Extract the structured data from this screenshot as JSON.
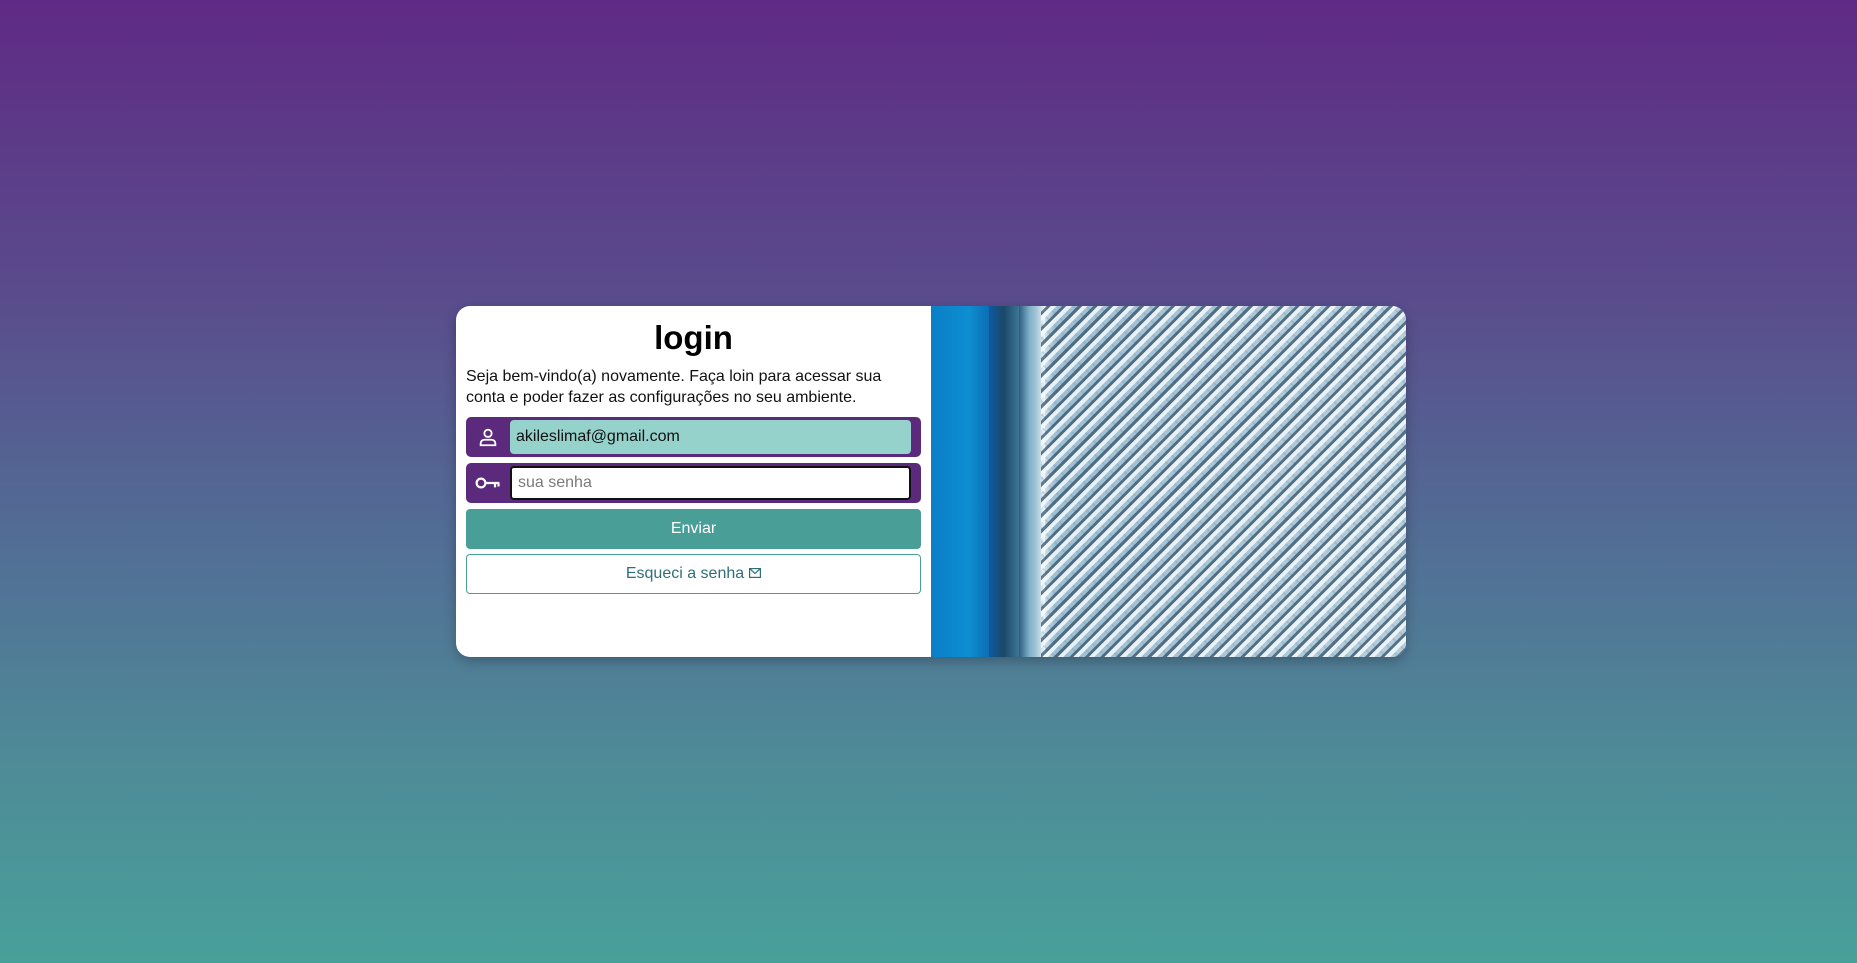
{
  "login": {
    "title": "login",
    "welcome": "Seja bem-vindo(a) novamente. Faça loin para acessar sua conta e poder fazer as configurações no seu ambiente.",
    "email": {
      "value": "akileslimaf@gmail.com",
      "icon": "user-icon"
    },
    "password": {
      "value": "",
      "placeholder": "sua senha",
      "icon": "key-icon"
    },
    "submit_label": "Enviar",
    "forgot_label": "Esqueci a senha",
    "forgot_icon": "envelope-icon"
  },
  "colors": {
    "field_bg": "#5c2a7d",
    "button_bg": "#4a9e98",
    "autofill_bg": "#96d2cc"
  }
}
